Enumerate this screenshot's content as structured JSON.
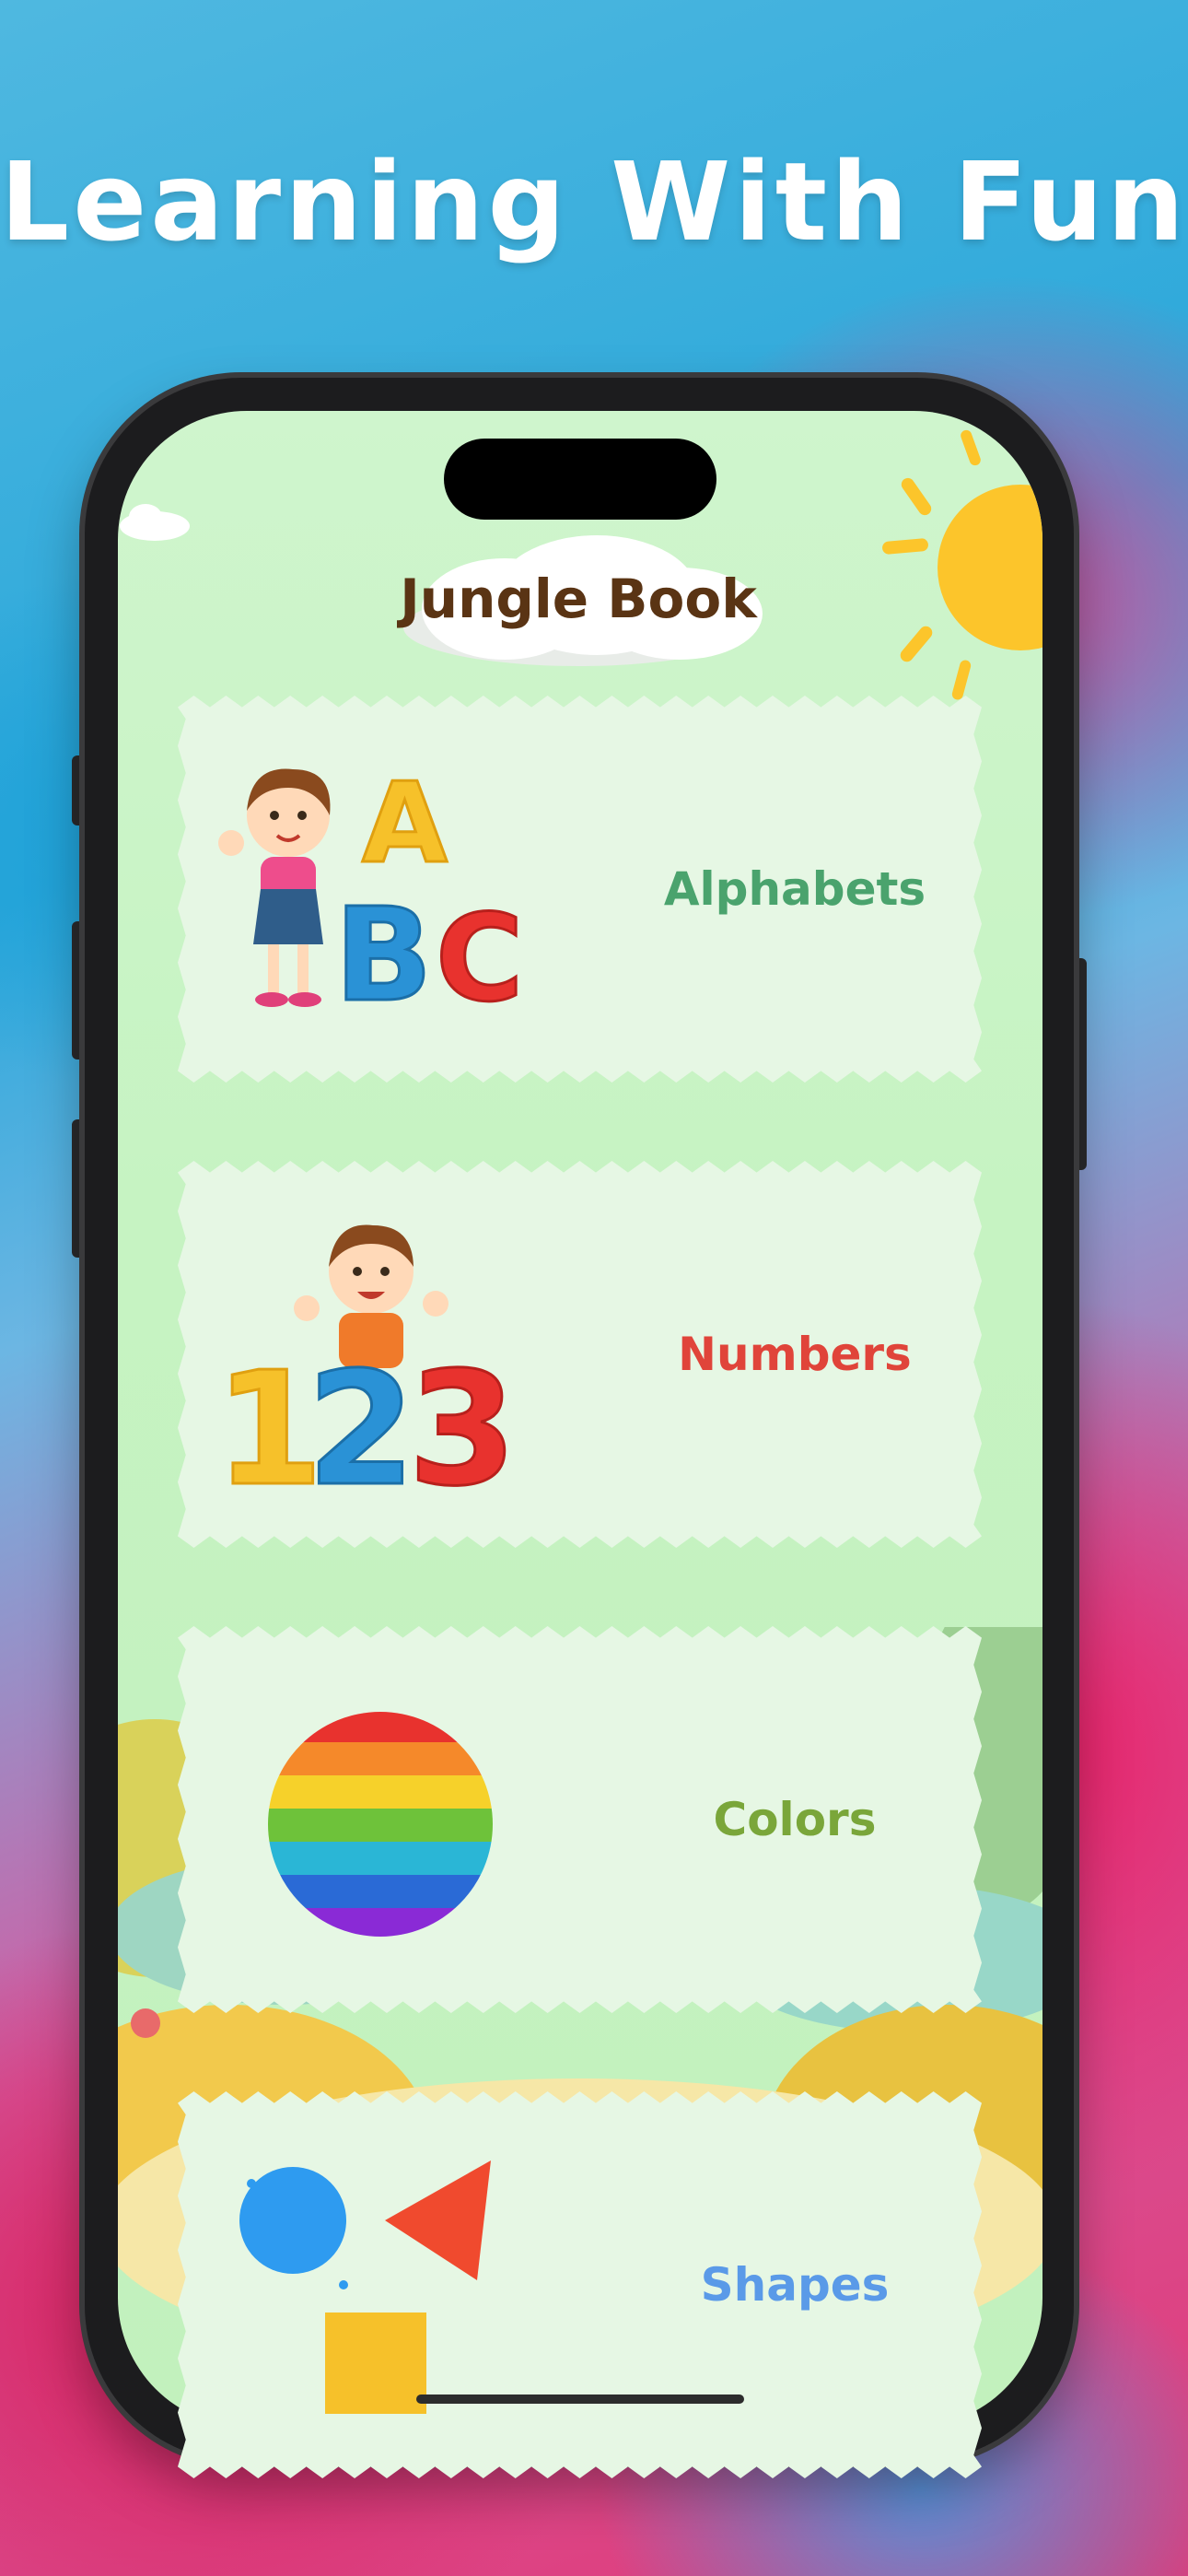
{
  "headline": "Learning With Fun",
  "app": {
    "title": "Jungle Book"
  },
  "cards": [
    {
      "label": "Alphabets",
      "color": "#4aa36d",
      "illustration_text": [
        "A",
        "B",
        "C"
      ]
    },
    {
      "label": "Numbers",
      "color": "#e0443a",
      "illustration_text": [
        "1",
        "2",
        "3"
      ]
    },
    {
      "label": "Colors",
      "color": "#7aa63a",
      "illustration": "rainbow-circle"
    },
    {
      "label": "Shapes",
      "color": "#5a9ae8",
      "illustration": "shapes-circle-triangle-square"
    }
  ]
}
